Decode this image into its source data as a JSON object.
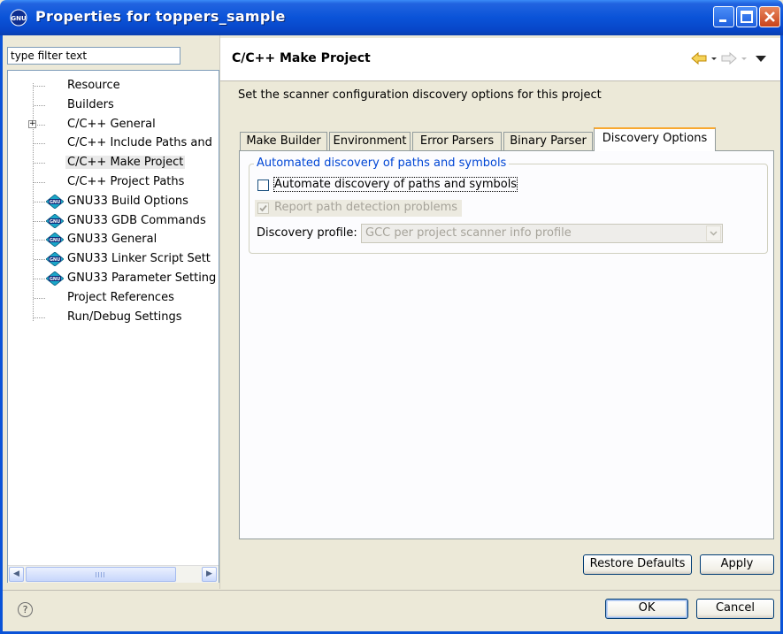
{
  "window": {
    "title": "Properties for toppers_sample",
    "colors": {
      "titlebar": "#0a53d8",
      "tab_highlight": "#f8a830",
      "group_title": "#0046d5"
    }
  },
  "filter": {
    "value": "type filter text"
  },
  "tree": {
    "items": [
      {
        "label": "Resource",
        "icon": "none",
        "selected": false
      },
      {
        "label": "Builders",
        "icon": "none",
        "selected": false
      },
      {
        "label": "C/C++ General",
        "icon": "expand-plus",
        "selected": false
      },
      {
        "label": "C/C++ Include Paths and",
        "icon": "none",
        "selected": false
      },
      {
        "label": "C/C++ Make Project",
        "icon": "none",
        "selected": true
      },
      {
        "label": "C/C++ Project Paths",
        "icon": "none",
        "selected": false
      },
      {
        "label": "GNU33 Build Options",
        "icon": "gnu-icon",
        "selected": false
      },
      {
        "label": "GNU33 GDB Commands",
        "icon": "gnu-icon",
        "selected": false
      },
      {
        "label": "GNU33 General",
        "icon": "gnu-icon",
        "selected": false
      },
      {
        "label": "GNU33 Linker Script Sett",
        "icon": "gnu-icon",
        "selected": false
      },
      {
        "label": "GNU33 Parameter Setting",
        "icon": "gnu-icon",
        "selected": false
      },
      {
        "label": "Project References",
        "icon": "none",
        "selected": false
      },
      {
        "label": "Run/Debug Settings",
        "icon": "none",
        "selected": false
      }
    ]
  },
  "page": {
    "title": "C/C++ Make Project",
    "description": "Set the scanner configuration discovery options for this project"
  },
  "tabs": [
    {
      "label": "Make Builder",
      "active": false
    },
    {
      "label": "Environment",
      "active": false
    },
    {
      "label": "Error Parsers",
      "active": false
    },
    {
      "label": "Binary Parser",
      "active": false
    },
    {
      "label": "Discovery Options",
      "active": true
    }
  ],
  "discovery": {
    "group_title": "Automated discovery of paths and symbols",
    "automate_label": "Automate discovery of paths and symbols",
    "automate_checked": false,
    "report_label": "Report path detection problems",
    "report_checked": true,
    "profile_label": "Discovery profile:",
    "profile_value": "GCC per project scanner info profile"
  },
  "buttons": {
    "restore_defaults": "Restore Defaults",
    "apply": "Apply",
    "ok": "OK",
    "cancel": "Cancel"
  }
}
